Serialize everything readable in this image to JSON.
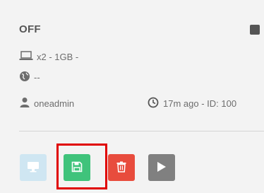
{
  "status": {
    "label": "OFF",
    "indicator_color": "#555555"
  },
  "hardware": {
    "icon": "laptop-icon",
    "text": "x2 - 1GB -"
  },
  "network": {
    "icon": "globe-icon",
    "text": "--"
  },
  "owner": {
    "icon": "user-icon",
    "text": "oneadmin"
  },
  "time": {
    "icon": "clock-icon",
    "text": "17m ago - ID: 100"
  },
  "actions": [
    {
      "name": "vnc",
      "icon": "desktop-icon",
      "color": "#cfe6f2"
    },
    {
      "name": "save",
      "icon": "floppy-disk-icon",
      "color": "#3fc37b"
    },
    {
      "name": "delete",
      "icon": "trash-icon",
      "color": "#e84c3d"
    },
    {
      "name": "play",
      "icon": "play-icon",
      "color": "#808080"
    }
  ],
  "highlight_color": "#e00000"
}
